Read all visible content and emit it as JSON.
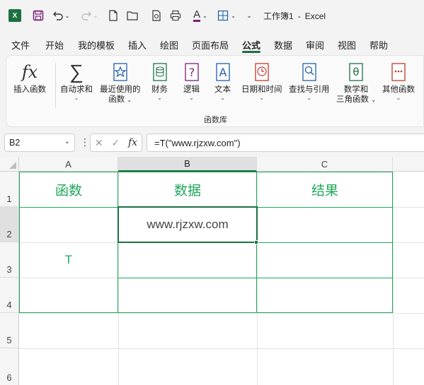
{
  "window": {
    "title": "工作簿1",
    "app_name": "Excel",
    "app_icon_letter": "X"
  },
  "quick_access": {
    "undo_icon": "undo-icon",
    "redo_icon": "redo-icon"
  },
  "tabs": [
    "文件",
    "开始",
    "我的模板",
    "插入",
    "绘图",
    "页面布局",
    "公式",
    "数据",
    "审阅",
    "视图",
    "帮助"
  ],
  "active_tab": "公式",
  "ribbon": {
    "insert_function": "插入函数",
    "autosum": "自动求和",
    "recent_line1": "最近使用的",
    "recent_line2": "函数",
    "financial": "财务",
    "logical": "逻辑",
    "text": "文本",
    "datetime": "日期和时间",
    "lookup": "查找与引用",
    "math_line1": "数学和",
    "math_line2": "三角函数",
    "more": "其他函数",
    "group_label": "函数库"
  },
  "formula_bar": {
    "name_box": "B2",
    "formula": "=T(\"www.rjzxw.com\")"
  },
  "sheet": {
    "columns": [
      "A",
      "B",
      "C"
    ],
    "rows": [
      "1",
      "2",
      "3",
      "4",
      "5",
      "6"
    ],
    "cells": {
      "A1": "函数",
      "B1": "数据",
      "C1": "结果",
      "A_merged": "T",
      "B2": "www.rjzxw.com"
    },
    "selected_cell": "B2"
  },
  "colors": {
    "accent": "#1d6f42",
    "table_green": "#1fa85a"
  }
}
